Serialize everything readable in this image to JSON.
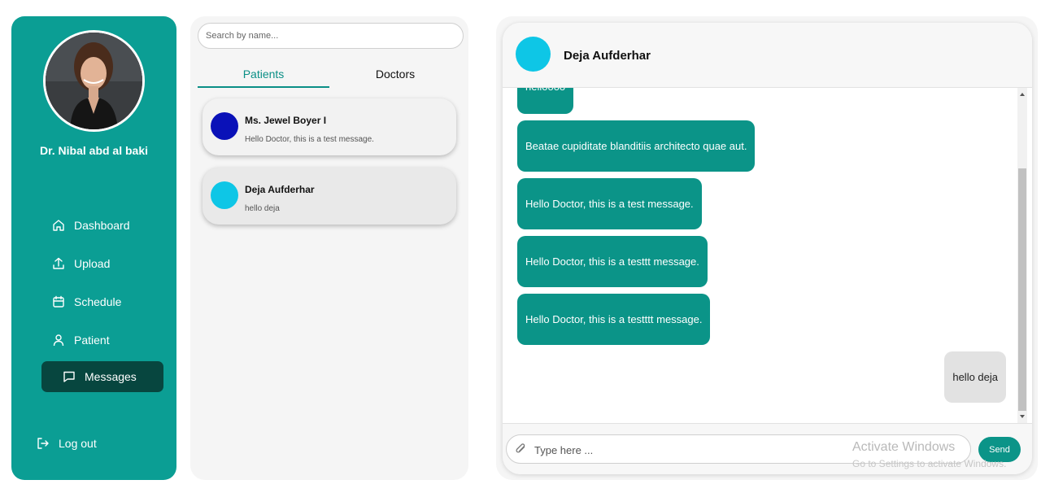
{
  "sidebar": {
    "doctor_name": "Dr. Nibal abd al baki",
    "nav": [
      {
        "label": "Dashboard",
        "icon": "home-icon"
      },
      {
        "label": "Upload",
        "icon": "upload-icon"
      },
      {
        "label": "Schedule",
        "icon": "calendar-icon"
      },
      {
        "label": "Patient",
        "icon": "user-icon"
      },
      {
        "label": "Messages",
        "icon": "message-icon",
        "active": true
      }
    ],
    "logout_label": "Log out",
    "color": "#0b9e94",
    "active_color": "#07463f"
  },
  "contacts": {
    "search_placeholder": "Search by name...",
    "tabs": [
      "Patients",
      "Doctors"
    ],
    "active_tab": "Patients",
    "list": [
      {
        "name": "Ms. Jewel Boyer I",
        "last_message": "Hello Doctor, this is a test message.",
        "avatar_color": "#0a11b8"
      },
      {
        "name": "Deja Aufderhar",
        "last_message": "hello deja",
        "avatar_color": "#0ec6e6",
        "selected": true
      }
    ]
  },
  "chat": {
    "contact_name": "Deja Aufderhar",
    "messages": [
      {
        "text": "helloooo",
        "from": "them"
      },
      {
        "text": "Beatae cupiditate blanditiis architecto quae aut.",
        "from": "them"
      },
      {
        "text": "Hello Doctor, this is a test message.",
        "from": "them"
      },
      {
        "text": "Hello Doctor, this is a testtt message.",
        "from": "them"
      },
      {
        "text": "Hello Doctor, this is a testttt message.",
        "from": "them"
      },
      {
        "text": "hello deja",
        "from": "me"
      }
    ],
    "input_placeholder": "Type here ...",
    "send_label": "Send",
    "bubble_color": "#0b9488"
  },
  "watermark": {
    "line1": "Activate Windows",
    "line2": "Go to Settings to activate Windows."
  }
}
